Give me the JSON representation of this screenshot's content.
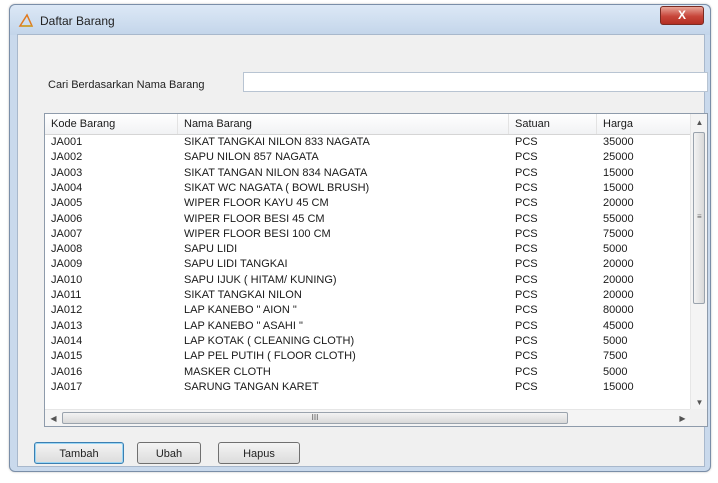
{
  "window": {
    "title": "Daftar Barang",
    "close_label": "X"
  },
  "search": {
    "label": "Cari Berdasarkan Nama Barang",
    "value": "",
    "placeholder": ""
  },
  "table": {
    "columns": [
      "Kode Barang",
      "Nama Barang",
      "Satuan",
      "Harga"
    ],
    "rows": [
      [
        "JA001",
        "SIKAT TANGKAI NILON 833 NAGATA",
        "PCS",
        "35000"
      ],
      [
        "JA002",
        "SAPU NILON 857 NAGATA",
        "PCS",
        "25000"
      ],
      [
        "JA003",
        "SIKAT TANGAN NILON 834 NAGATA",
        "PCS",
        "15000"
      ],
      [
        "JA004",
        "SIKAT WC NAGATA ( BOWL BRUSH)",
        "PCS",
        "15000"
      ],
      [
        "JA005",
        "WIPER FLOOR KAYU 45 CM",
        "PCS",
        "20000"
      ],
      [
        "JA006",
        "WIPER FLOOR BESI 45 CM",
        "PCS",
        "55000"
      ],
      [
        "JA007",
        "WIPER FLOOR BESI 100 CM",
        "PCS",
        "75000"
      ],
      [
        "JA008",
        "SAPU LIDI",
        "PCS",
        "5000"
      ],
      [
        "JA009",
        "SAPU LIDI TANGKAI",
        "PCS",
        "20000"
      ],
      [
        "JA010",
        "SAPU IJUK ( HITAM/ KUNING)",
        "PCS",
        "20000"
      ],
      [
        "JA011",
        "SIKAT TANGKAI NILON",
        "PCS",
        "20000"
      ],
      [
        "JA012",
        "LAP KANEBO \" AION \"",
        "PCS",
        "80000"
      ],
      [
        "JA013",
        "LAP KANEBO \" ASAHI \"",
        "PCS",
        "45000"
      ],
      [
        "JA014",
        "LAP KOTAK ( CLEANING CLOTH)",
        "PCS",
        "5000"
      ],
      [
        "JA015",
        "LAP PEL PUTIH ( FLOOR CLOTH)",
        "PCS",
        "7500"
      ],
      [
        "JA016",
        "MASKER CLOTH",
        "PCS",
        "5000"
      ],
      [
        "JA017",
        "SARUNG TANGAN KARET",
        "PCS",
        "15000"
      ]
    ]
  },
  "scrollbars": {
    "up_icon": "arrow-up-icon",
    "down_icon": "arrow-down-icon",
    "left_icon": "arrow-left-icon",
    "right_icon": "arrow-right-icon",
    "h_grip": "III"
  },
  "buttons": {
    "add": "Tambah",
    "edit": "Ubah",
    "delete": "Hapus"
  }
}
